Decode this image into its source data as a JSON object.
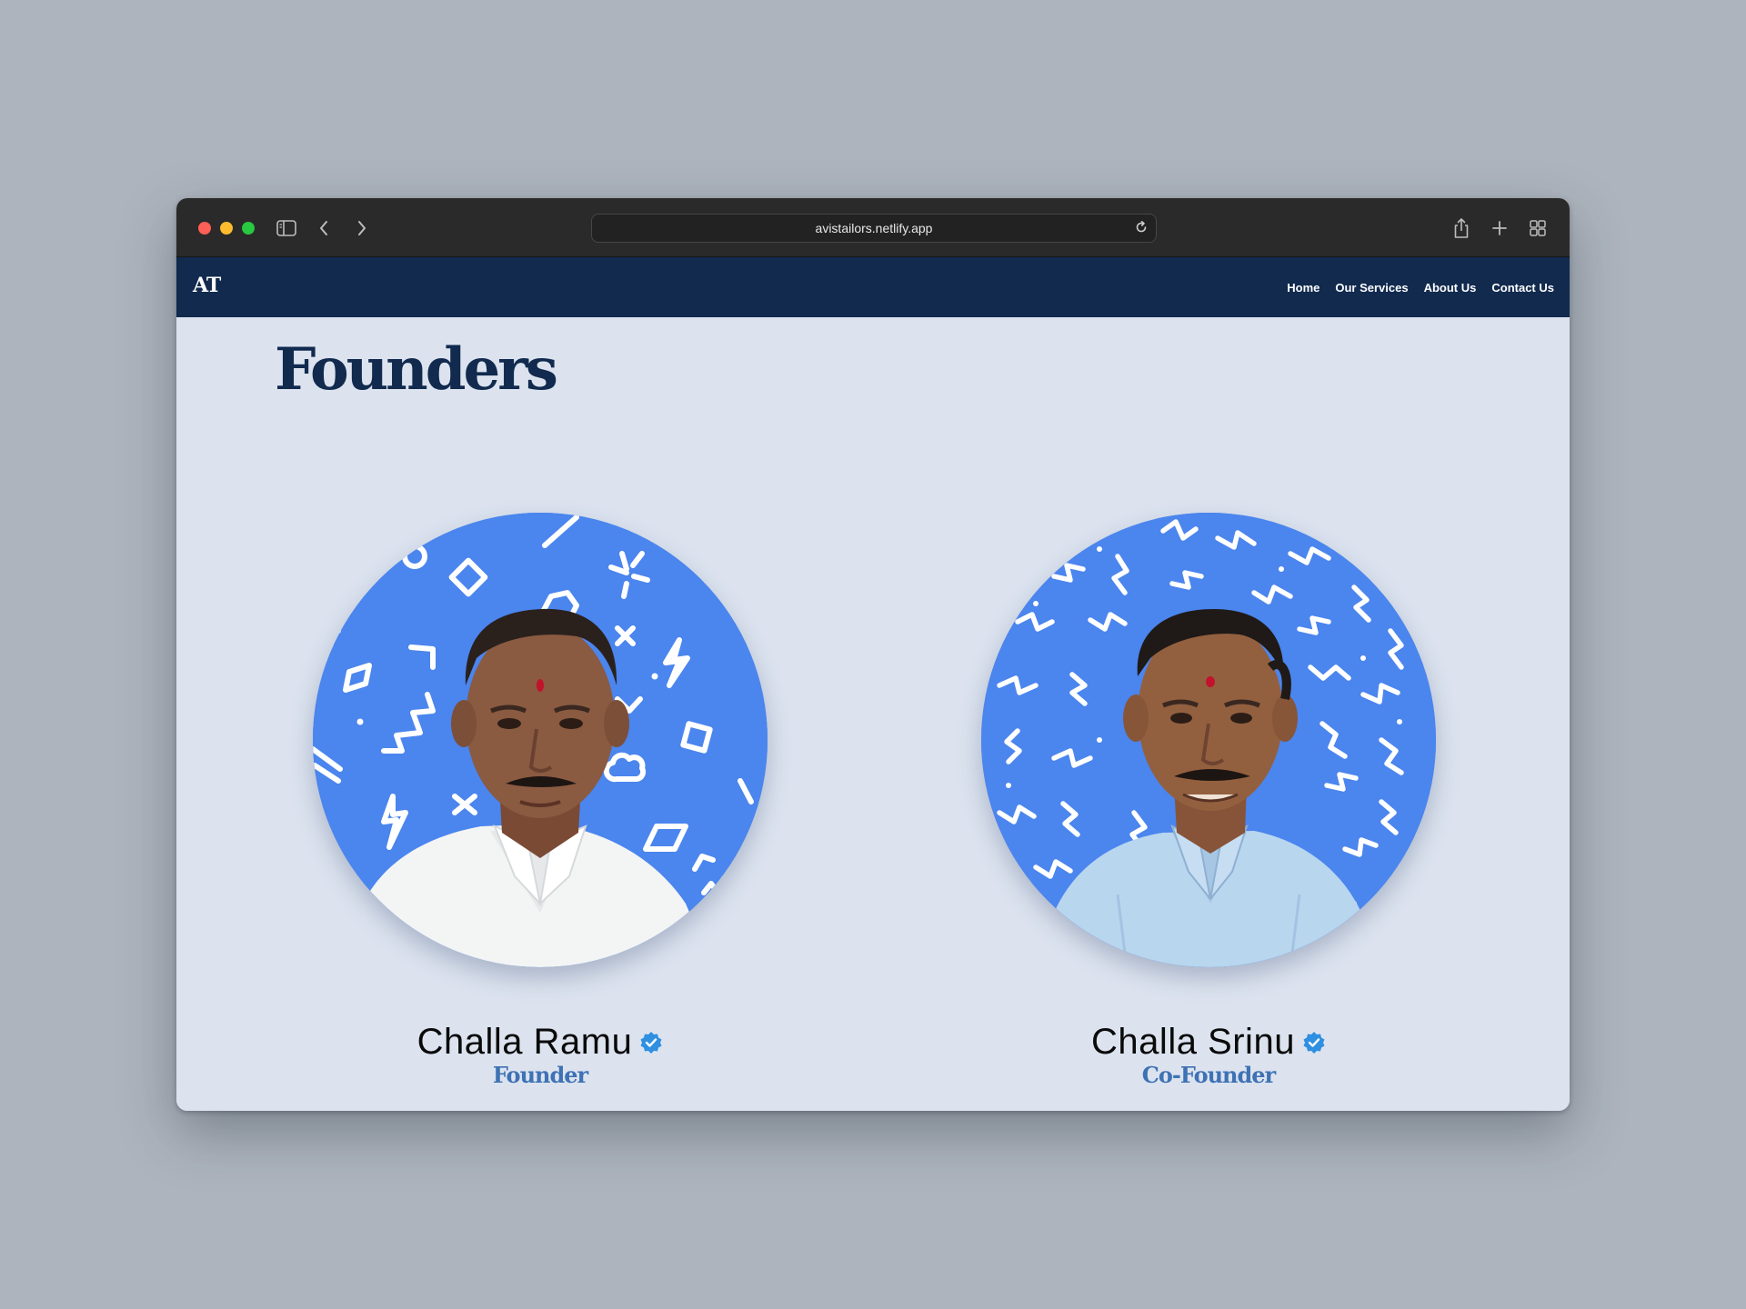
{
  "browser": {
    "url": "avistailors.netlify.app",
    "icons": [
      "sidebar-icon",
      "chevron-left-icon",
      "chevron-right-icon",
      "reload-icon",
      "share-icon",
      "plus-icon",
      "tab-overview-icon"
    ]
  },
  "site": {
    "logo": "AT",
    "nav": [
      "Home",
      "Our Services",
      "About Us",
      "Contact Us"
    ]
  },
  "page": {
    "heading": "Founders",
    "founders": [
      {
        "name": "Challa Ramu",
        "role": "Founder"
      },
      {
        "name": "Challa Srinu",
        "role": "Co-Founder"
      }
    ]
  },
  "colors": {
    "nav_bg": "#112a4e",
    "page_bg": "#dce3ef",
    "avatar_bg": "#4b85ee",
    "role_text": "#3e72b4",
    "verified": "#2f8fe0"
  }
}
